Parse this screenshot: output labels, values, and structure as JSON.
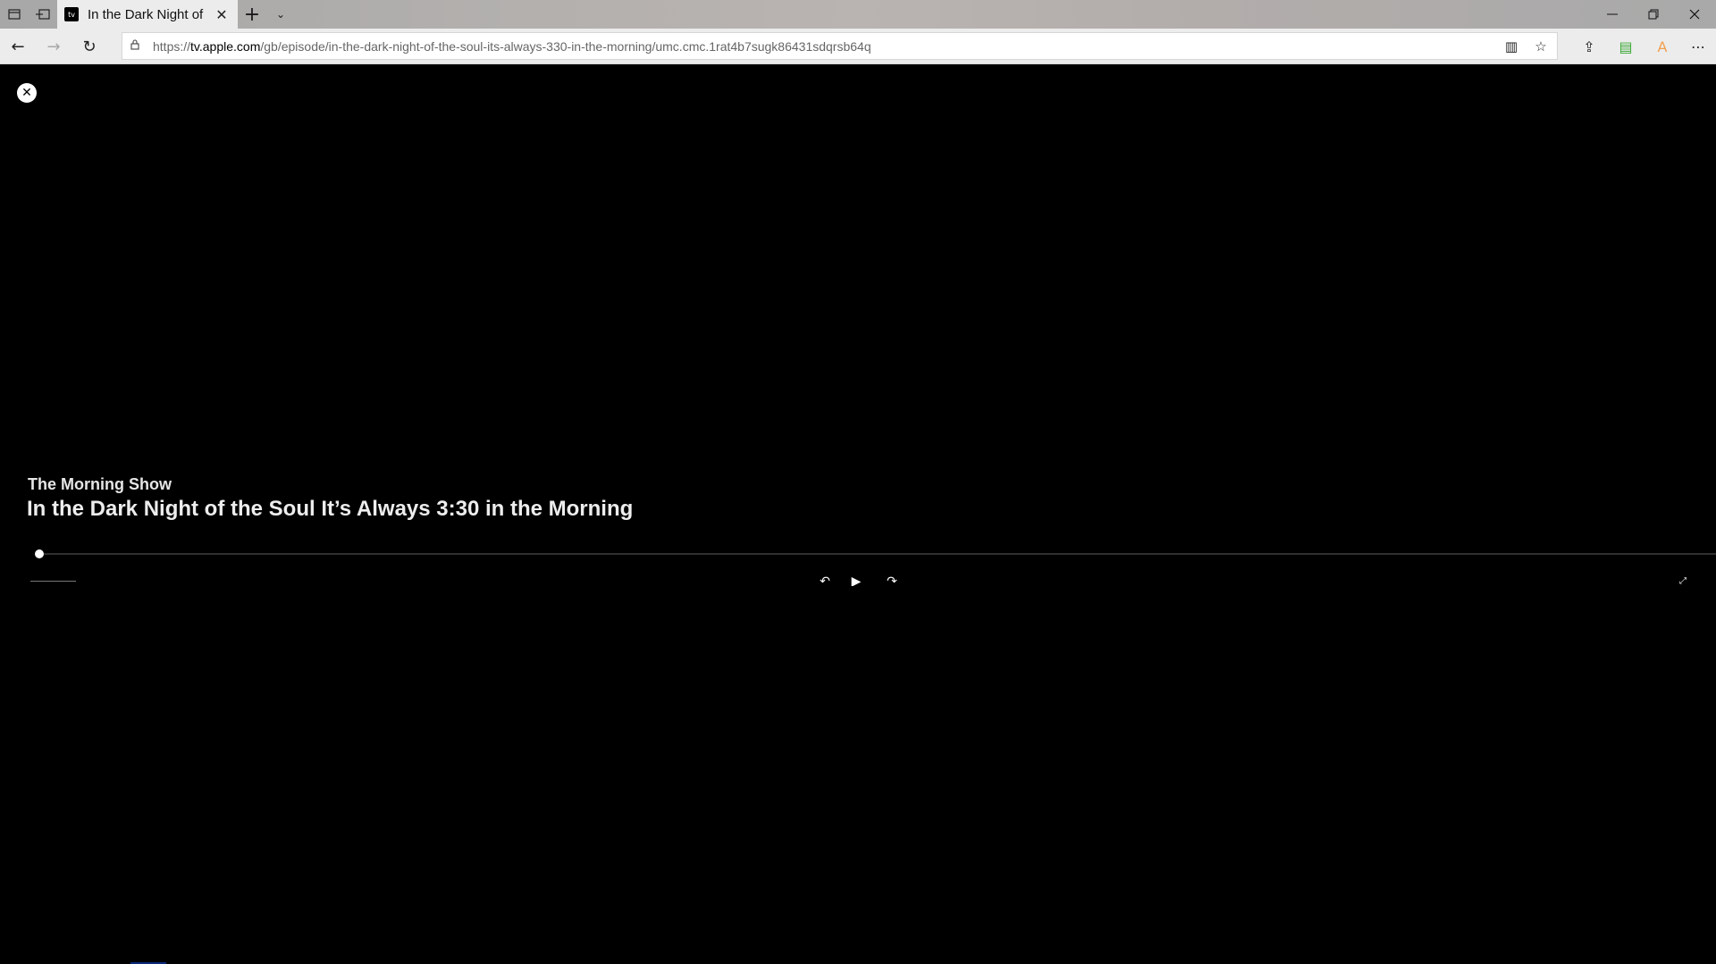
{
  "browser": {
    "tab": {
      "title": "In the Dark Night of",
      "favicon_text": "tv"
    },
    "tab_controls": {
      "tabs_aside_icon": "tabs-aside-icon",
      "tab_preview_icon": "tab-preview-icon",
      "new_tab_glyph": "+",
      "tab_list_glyph": "⌄",
      "close_tab_glyph": "✕"
    },
    "window_controls": {
      "minimize_glyph": "—",
      "restore_glyph": "❐",
      "close_glyph": "✕"
    },
    "nav": {
      "back_glyph": "←",
      "forward_glyph": "→",
      "refresh_glyph": "↻"
    },
    "address": {
      "scheme": "https://",
      "host": "tv.apple.com",
      "path": "/gb/episode/in-the-dark-night-of-the-soul-its-always-330-in-the-morning/umc.cmc.1rat4b7sugk86431sdqrsb64q"
    },
    "toolbar": {
      "reading_view_glyph": "▥",
      "favorite_glyph": "☆",
      "share_glyph": "⇪",
      "extension_glyph": "▤",
      "extension_color": "#3aa835",
      "profile_glyph": "A",
      "profile_color": "#f0a050",
      "more_glyph": "⋯"
    }
  },
  "player": {
    "close_glyph": "✕",
    "show_title": "The Morning Show",
    "episode_title": "In the Dark Night of the Soul It’s Always 3:30 in the Morning",
    "progress": 0.0,
    "controls": {
      "skip_back_glyph": "↶",
      "play_glyph": "▶",
      "skip_forward_glyph": "↷",
      "fullscreen_glyph": "⤢"
    }
  }
}
